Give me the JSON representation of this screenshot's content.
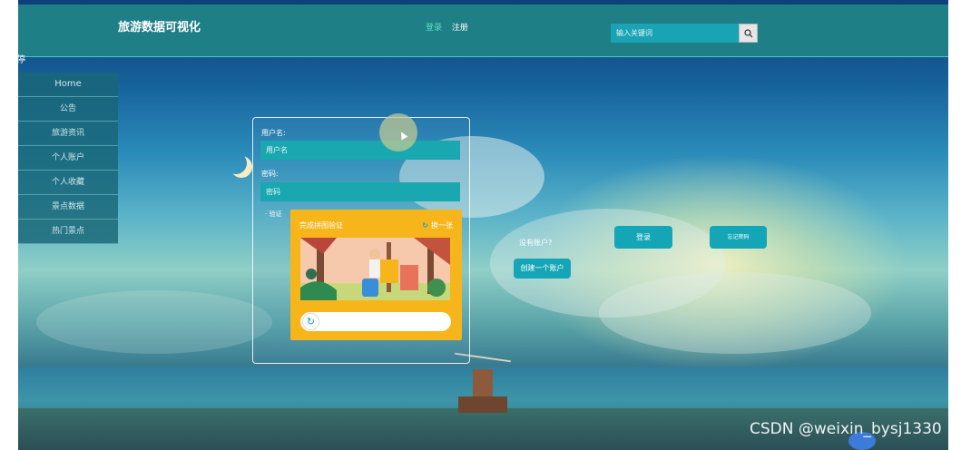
{
  "header": {
    "site_title": "旅游数据可视化",
    "login_link": "登录",
    "register_link": "注册",
    "search_placeholder": "输入关键词"
  },
  "pause_label": "暂停",
  "sidebar": {
    "items": [
      {
        "label": "Home"
      },
      {
        "label": "公告"
      },
      {
        "label": "旅游资讯"
      },
      {
        "label": "个人账户"
      },
      {
        "label": "个人收藏"
      },
      {
        "label": "景点数据"
      },
      {
        "label": "热门景点"
      }
    ]
  },
  "login_form": {
    "username_label": "用户名:",
    "username_placeholder": "用户名",
    "password_label": "密码:",
    "password_placeholder": "密码",
    "verify_label": "验证"
  },
  "captcha": {
    "title": "完成拼图验证",
    "refresh_label": "换一张"
  },
  "actions": {
    "no_account_text": "没有账户?",
    "create_account_button": "创建一个账户",
    "login_button": "登录",
    "forgot_password_button": "忘记密码"
  },
  "watermark": "CSDN @weixin_bysj1330",
  "colors": {
    "header_bg": "#1f7f86",
    "accent_teal": "#14a6b7",
    "captcha_bg": "#f7b51c"
  }
}
